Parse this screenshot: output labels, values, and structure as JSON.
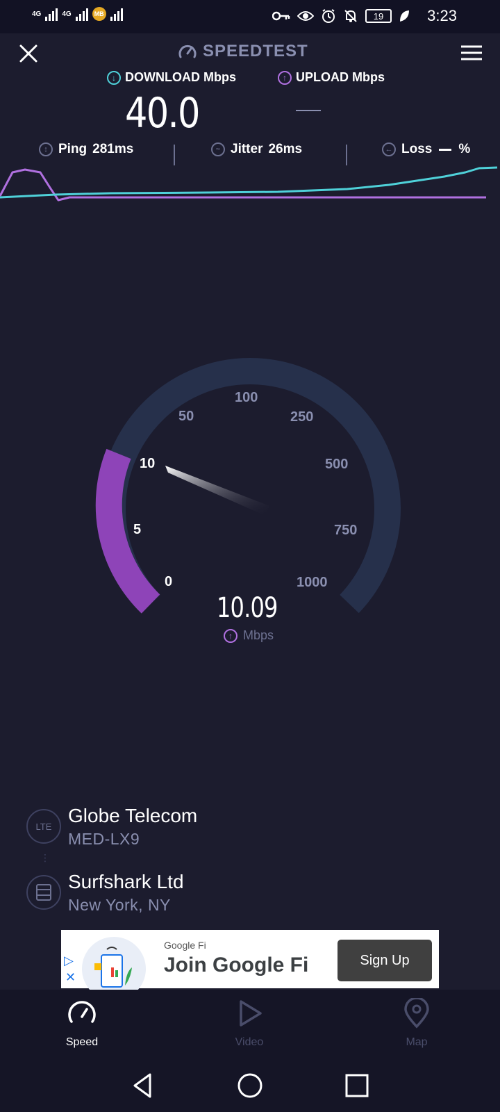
{
  "status_bar": {
    "network_1": "4G",
    "network_2": "4G",
    "battery": "19",
    "time": "3:23",
    "coin_label": "MB"
  },
  "header": {
    "title": "SPEEDTEST"
  },
  "speeds": {
    "download_label": "DOWNLOAD Mbps",
    "upload_label": "UPLOAD Mbps",
    "download_value": "40.0"
  },
  "metrics": {
    "ping_label": "Ping",
    "ping_value": "281ms",
    "jitter_label": "Jitter",
    "jitter_value": "26ms",
    "loss_label": "Loss",
    "loss_value": "%"
  },
  "gauge": {
    "ticks": [
      "0",
      "5",
      "10",
      "50",
      "100",
      "250",
      "500",
      "750",
      "1000"
    ],
    "current_value": "10.09",
    "unit": "Mbps"
  },
  "connection": {
    "isp_name": "Globe Telecom",
    "device": "MED-LX9",
    "icon_label": "LTE",
    "server_name": "Surfshark Ltd",
    "server_location": "New York, NY"
  },
  "ad": {
    "sponsor": "Google Fi",
    "title": "Join Google Fi",
    "button": "Sign Up"
  },
  "bottom_nav": {
    "items": [
      {
        "label": "Speed"
      },
      {
        "label": "Video"
      },
      {
        "label": "Map"
      }
    ]
  },
  "colors": {
    "background": "#1c1c2e",
    "download_accent": "#4fd1d9",
    "upload_accent": "#b070e0",
    "gauge_track": "#26304b",
    "gauge_fill": "#8e44b8"
  }
}
